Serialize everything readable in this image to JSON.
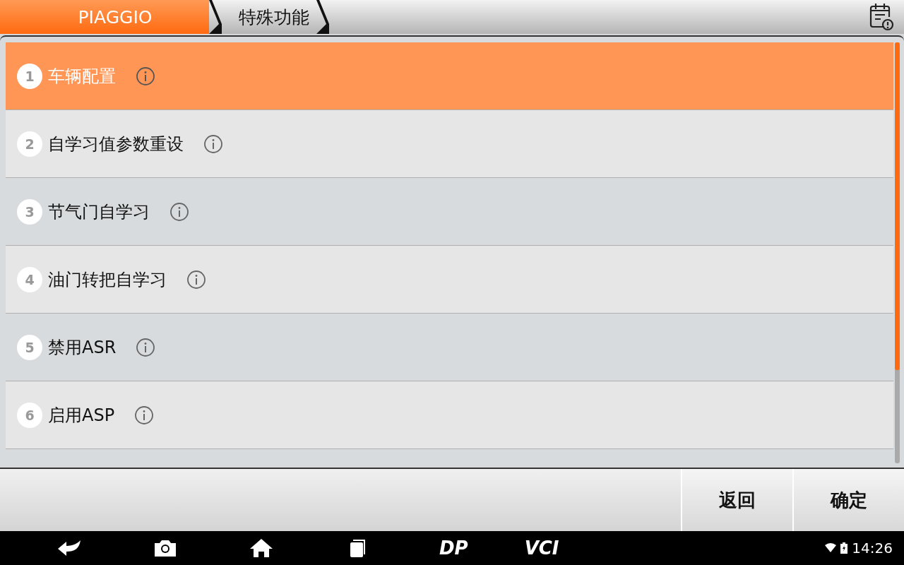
{
  "breadcrumb": [
    {
      "label": "PIAGGIO",
      "selected": true
    },
    {
      "label": "特殊功能",
      "selected": false
    }
  ],
  "items": [
    {
      "number": "1",
      "label": "车辆配置",
      "selected": true
    },
    {
      "number": "2",
      "label": "自学习值参数重设",
      "selected": false
    },
    {
      "number": "3",
      "label": "节气门自学习",
      "selected": false
    },
    {
      "number": "4",
      "label": "油门转把自学习",
      "selected": false
    },
    {
      "number": "5",
      "label": "禁用ASR",
      "selected": false
    },
    {
      "number": "6",
      "label": "启用ASP",
      "selected": false
    }
  ],
  "buttons": [
    "返回",
    "确定"
  ],
  "nav_bar": {
    "logos": [
      "DP",
      "VCI"
    ],
    "time": "14:26"
  }
}
